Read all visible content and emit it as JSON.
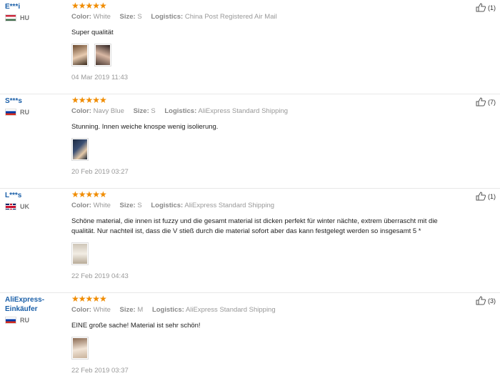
{
  "reviews": [
    {
      "name": "E***i",
      "country": "HU",
      "stars": "★★★★★",
      "color_label": "Color:",
      "color": "White",
      "size_label": "Size:",
      "size": "S",
      "logistics_label": "Logistics:",
      "logistics": "China Post Registered Air Mail",
      "text": "Super qualität",
      "date": "04 Mar 2019 11:43",
      "helpful": "(1)"
    },
    {
      "name": "S***s",
      "country": "RU",
      "stars": "★★★★★",
      "color_label": "Color:",
      "color": "Navy Blue",
      "size_label": "Size:",
      "size": "S",
      "logistics_label": "Logistics:",
      "logistics": "AliExpress Standard Shipping",
      "text": "Stunning. Innen weiche knospe wenig isolierung.",
      "date": "20 Feb 2019 03:27",
      "helpful": "(7)"
    },
    {
      "name": "L***s",
      "country": "UK",
      "stars": "★★★★★",
      "color_label": "Color:",
      "color": "White",
      "size_label": "Size:",
      "size": "S",
      "logistics_label": "Logistics:",
      "logistics": "AliExpress Standard Shipping",
      "text": "Schöne material, die innen ist fuzzy und die gesamt material ist dicken perfekt für winter nächte, extrem überrascht mit die qualität. Nur nachteil ist, dass die V stieß durch die material sofort aber das kann festgelegt werden so insgesamt 5 *",
      "date": "22 Feb 2019 04:43",
      "helpful": "(1)"
    },
    {
      "name": "AliExpress-Einkäufer",
      "country": "RU",
      "stars": "★★★★★",
      "color_label": "Color:",
      "color": "White",
      "size_label": "Size:",
      "size": "M",
      "logistics_label": "Logistics:",
      "logistics": "AliExpress Standard Shipping",
      "text": "EINE große sache! Material ist sehr schön!",
      "date": "22 Feb 2019 03:37",
      "helpful": "(3)"
    }
  ],
  "colors": {
    "star": "#f08c00",
    "username": "#1a5fa8"
  },
  "icons": {
    "helpful": "thumbs-up-icon"
  }
}
